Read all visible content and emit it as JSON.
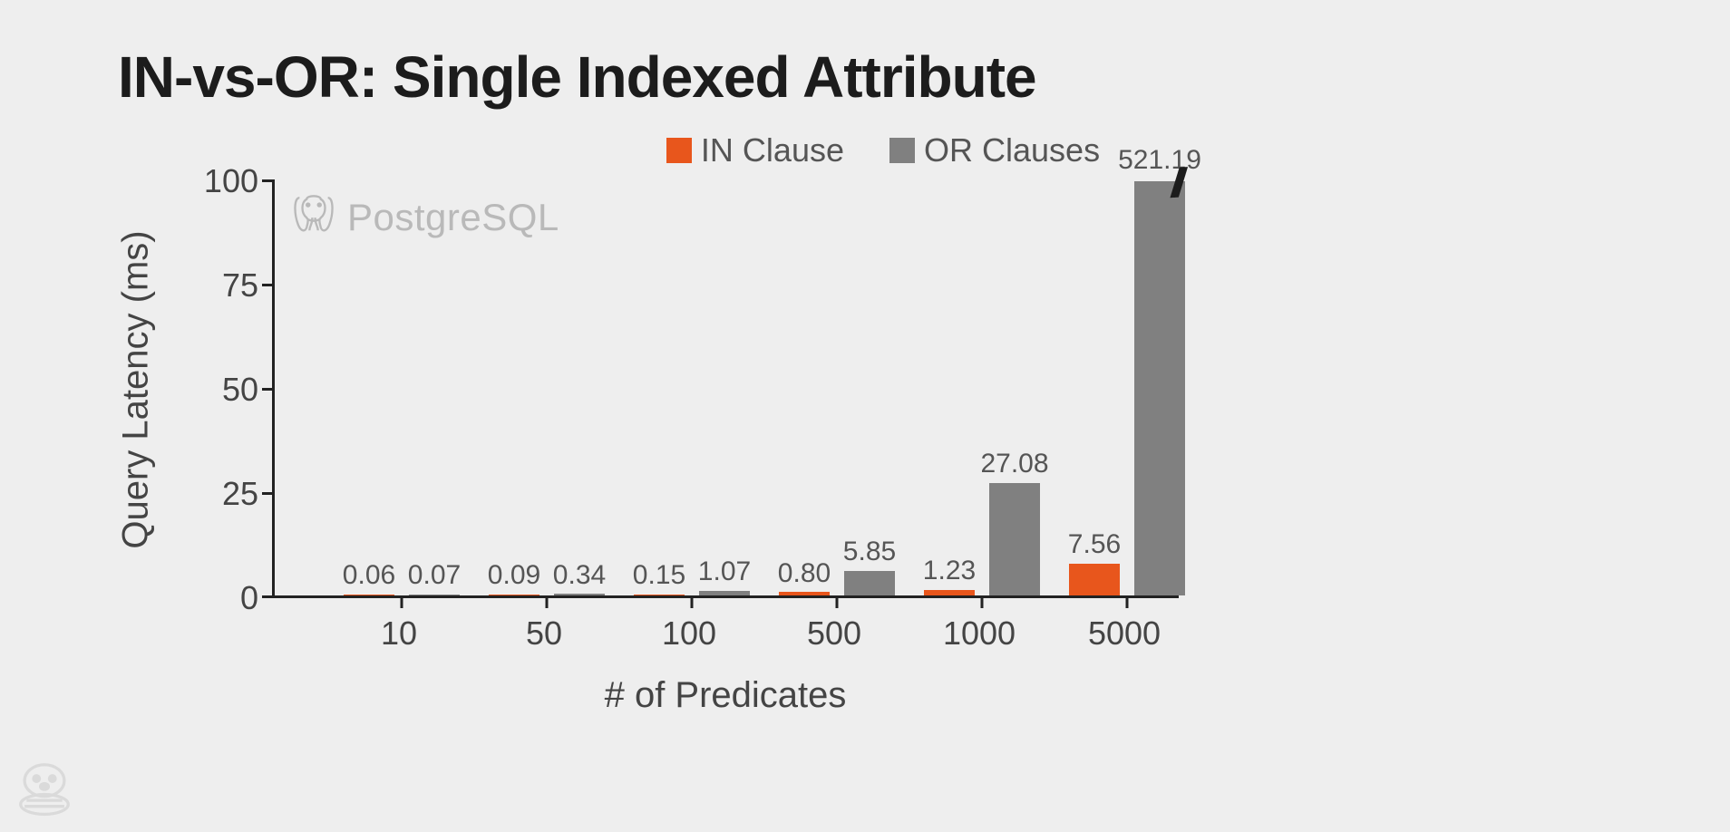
{
  "chart_data": {
    "type": "bar",
    "title": "IN-vs-OR: Single Indexed Attribute",
    "xlabel": "# of Predicates",
    "ylabel": "Query Latency (ms)",
    "ylim": [
      0,
      100
    ],
    "yticks": [
      0,
      25,
      50,
      75,
      100
    ],
    "categories": [
      "10",
      "50",
      "100",
      "500",
      "1000",
      "5000"
    ],
    "series": [
      {
        "name": "IN Clause",
        "color": "#e8561c",
        "values": [
          0.06,
          0.09,
          0.15,
          0.8,
          1.23,
          7.56
        ]
      },
      {
        "name": "OR Clauses",
        "color": "#808080",
        "values": [
          0.07,
          0.34,
          1.07,
          5.85,
          27.08,
          521.19
        ]
      }
    ],
    "value_labels": {
      "IN Clause": [
        "0.06",
        "0.09",
        "0.15",
        "0.80",
        "1.23",
        "7.56"
      ],
      "OR Clauses": [
        "0.07",
        "0.34",
        "1.07",
        "5.85",
        "27.08",
        "521.19"
      ]
    },
    "annotation": "PostgreSQL",
    "axis_break_on": {
      "series": "OR Clauses",
      "category": "5000"
    }
  }
}
